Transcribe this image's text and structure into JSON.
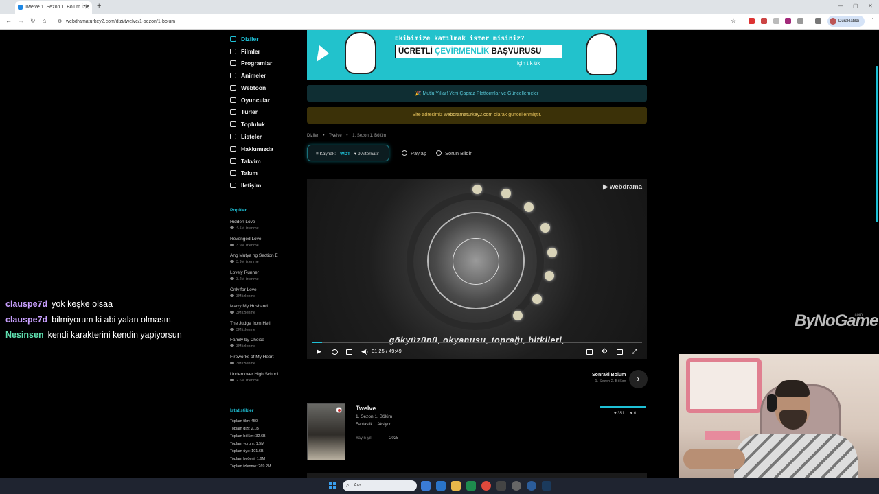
{
  "browser": {
    "tab_title": "Twelve 1. Sezon 1. Bölüm İzle",
    "url": "webdramaturkey2.com/dizi/twelve/1-sezon/1-bolum",
    "profile_name": "Duraklatıldı"
  },
  "chat": [
    {
      "user": "clauspe7d",
      "message": "yok keşke olsaa"
    },
    {
      "user": "clauspe7d",
      "message": "bilmiyorum ki abi yalan olmasın"
    },
    {
      "user": "Nesinsen",
      "message": "kendi karakterini kendin yapiyorsun"
    }
  ],
  "sidebar": {
    "menu": [
      "Diziler",
      "Filmler",
      "Programlar",
      "Animeler",
      "Webtoon",
      "Oyuncular",
      "Türler",
      "Topluluk",
      "Listeler",
      "Hakkımızda",
      "Takvim",
      "Takım",
      "İletişim"
    ],
    "popular_title": "Popüler",
    "popular": [
      {
        "title": "Hidden Love",
        "views": "4.5M izlenme"
      },
      {
        "title": "Revenged Love",
        "views": "3.9M izlenme"
      },
      {
        "title": "Ang Mutya ng Section E",
        "views": "3.9M izlenme"
      },
      {
        "title": "Lovely Runner",
        "views": "3.2M izlenme"
      },
      {
        "title": "Only for Love",
        "views": "3M izlenme"
      },
      {
        "title": "Marry My Husband",
        "views": "3M izlenme"
      },
      {
        "title": "The Judge from Hell",
        "views": "3M izlenme"
      },
      {
        "title": "Family by Choice",
        "views": "3M izlenme"
      },
      {
        "title": "Fireworks of My Heart",
        "views": "3M izlenme"
      },
      {
        "title": "Undercover High School",
        "views": "2.6M izlenme"
      }
    ],
    "stats_title": "İstatistikler",
    "stats": [
      "Toplam film: 450",
      "Toplam dizi: 2.1B",
      "Toplam bölüm: 32.6B",
      "Toplam yorum: 1.5M",
      "Toplam üye: 101.6B",
      "Toplam beğeni: 1.6M",
      "Toplam izlenme: 269.2M"
    ]
  },
  "banner": {
    "question": "Ekibimize katılmak ister misiniz?",
    "cta_part1": "ÜCRETLİ ",
    "cta_highlight": "ÇEVİRMENLİK",
    "cta_part2": " BAŞVURUSU",
    "sub": "için tık tık"
  },
  "notices": {
    "new_year": "🎉 Mutlu Yıllar! Yeni Çapraz Platformlar ve Güncellemeler",
    "domain_prefix": "Site adresimiz ",
    "domain": "webdramaturkey2.com",
    "domain_suffix": " olarak güncellenmiştir."
  },
  "breadcrumb": [
    "Diziler",
    "•",
    "Twelve",
    "•",
    "1. Sezon 1. Bölüm"
  ],
  "player_bar": {
    "source_label": "≡ Kaynak:",
    "source_value": "WDT",
    "alternatives": "▾ 9 Alternatif",
    "share": "Paylaş",
    "report": "Sorun Bildir"
  },
  "video": {
    "brand": "▶ webdrama",
    "subtitle": "gökyüzünü, okyanusu, toprağı, bitkileri,",
    "current_time": "01:25",
    "separator": "/",
    "duration": "49:49",
    "progress": 0.029
  },
  "next_episode": {
    "label": "Sonraki Bölüm",
    "episode": "1. Sezon 2. Bölüm"
  },
  "show": {
    "title": "Twelve",
    "episode": "1. Sezon 1. Bölüm",
    "genres": [
      "Fantastik",
      "Aksiyon"
    ],
    "year_label": "Yayın yılı",
    "year": "2025",
    "likes": "351",
    "dislikes": "6"
  },
  "watermark": {
    "text": "ByNoGame",
    "suffix": ".com"
  },
  "taskbar": {
    "search_placeholder": "Ara"
  },
  "colors": {
    "accent": "#1ec0d6",
    "banner": "#22c2cc",
    "notice_gold": "#e6c25a"
  }
}
